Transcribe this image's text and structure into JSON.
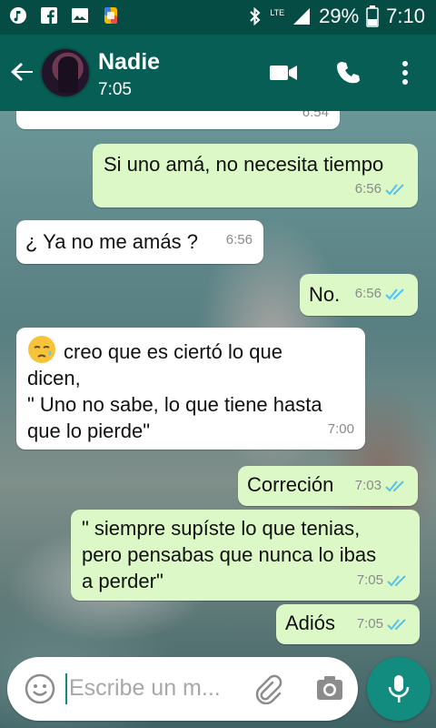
{
  "status_bar": {
    "network": "LTE",
    "battery": "29%",
    "time": "7:10",
    "icons": [
      "music-icon",
      "facebook-icon",
      "gallery-icon",
      "app-icon",
      "bluetooth-icon",
      "signal-icon",
      "battery-icon"
    ]
  },
  "header": {
    "contact_name": "Nadie",
    "contact_status": "7:05",
    "icons": [
      "back-arrow-icon",
      "video-call-icon",
      "phone-icon",
      "more-vert-icon"
    ]
  },
  "messages": [
    {
      "direction": "in",
      "text": "",
      "time": "6:54",
      "read": false
    },
    {
      "direction": "out",
      "text": "Si uno amá, no necesita tiempo",
      "time": "6:56",
      "read": true
    },
    {
      "direction": "in",
      "text": "¿ Ya no me amás ?",
      "time": "6:56",
      "read": false
    },
    {
      "direction": "out",
      "text": "No.",
      "time": "6:56",
      "read": true
    },
    {
      "direction": "in",
      "emoji": "sleepy-face-icon",
      "lines": [
        "creo que es ciertó lo que",
        "dicen,",
        "\" Uno no sabe, lo que tiene hasta",
        "que lo pierde\""
      ],
      "time": "7:00",
      "read": false
    },
    {
      "direction": "out",
      "text": "Correción",
      "time": "7:03",
      "read": true
    },
    {
      "direction": "out",
      "lines": [
        "\" siempre supíste lo que tenias,",
        "pero pensabas que nunca lo ibas",
        "a perder\""
      ],
      "time": "7:05",
      "read": true
    },
    {
      "direction": "out",
      "text": "Adiós",
      "time": "7:05",
      "read": true
    }
  ],
  "composer": {
    "placeholder": "Escribe un m...",
    "icons": [
      "emoji-icon",
      "attach-icon",
      "camera-icon",
      "mic-icon"
    ]
  },
  "colors": {
    "header": "#075e54",
    "status_bar": "#054d44",
    "outgoing_bubble": "#dcf8c6",
    "incoming_bubble": "#ffffff",
    "read_ticks": "#4fc3f7",
    "fab": "#128c7e"
  }
}
